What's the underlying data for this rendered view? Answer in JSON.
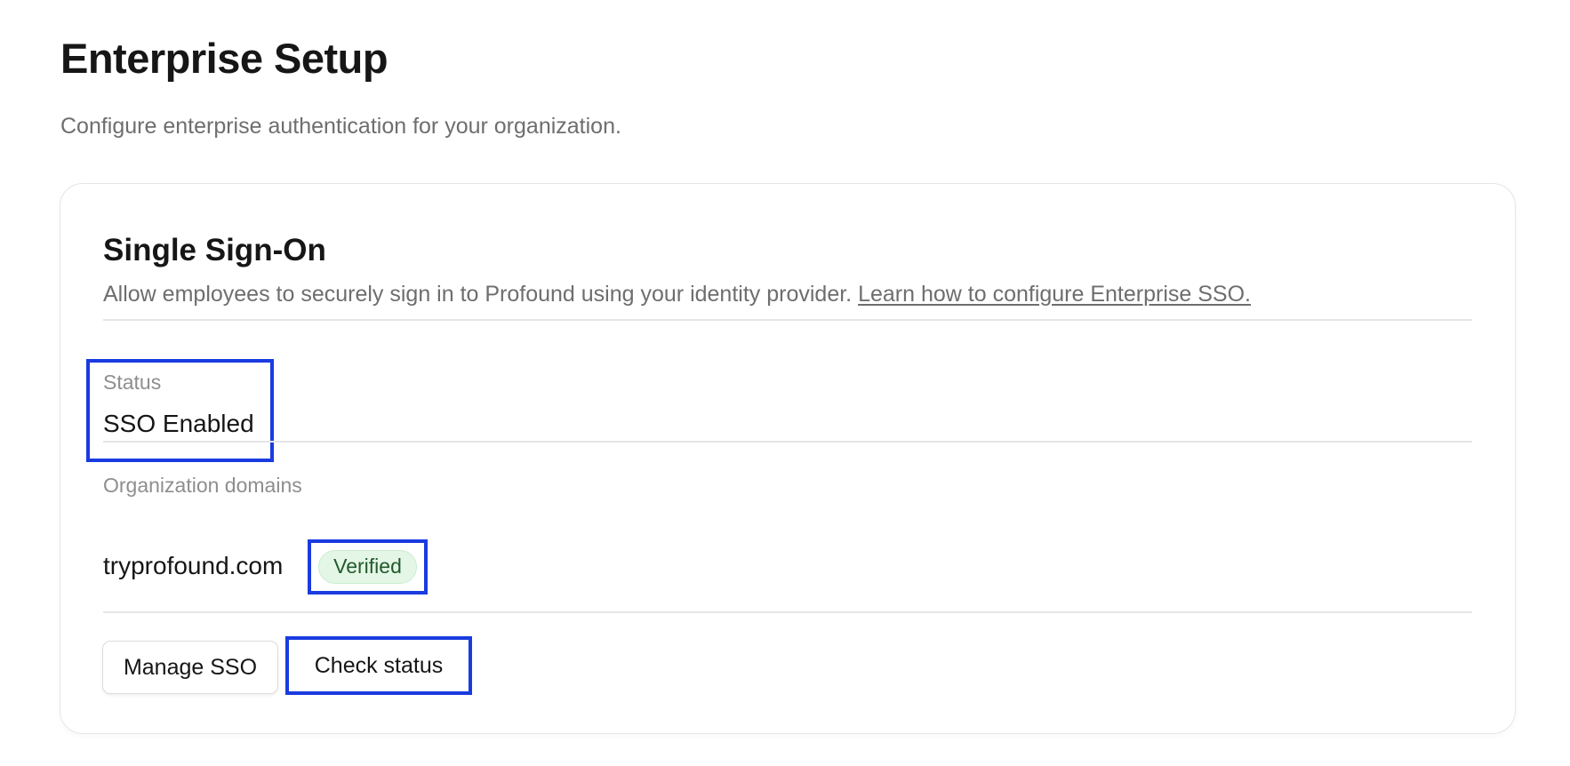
{
  "page": {
    "title": "Enterprise Setup",
    "subtitle": "Configure enterprise authentication for your organization."
  },
  "sso_card": {
    "title": "Single Sign-On",
    "description": "Allow employees to securely sign in to Profound using your identity provider.",
    "learn_link": "Learn how to configure Enterprise SSO.",
    "status": {
      "label": "Status",
      "value": "SSO Enabled"
    },
    "domains": {
      "label": "Organization domains",
      "value": "tryprofound.com",
      "badge": "Verified"
    },
    "buttons": {
      "manage": "Manage SSO",
      "check": "Check status"
    }
  },
  "colors": {
    "highlight_border": "#1a3be0",
    "badge_bg": "#e4f7e6",
    "badge_text": "#215a2c"
  }
}
